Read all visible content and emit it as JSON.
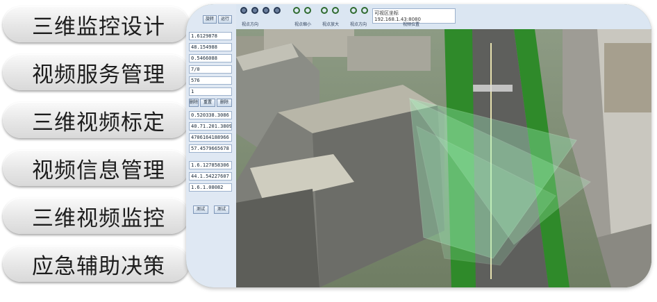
{
  "menu": {
    "items": [
      {
        "label": "三维监控设计"
      },
      {
        "label": "视频服务管理"
      },
      {
        "label": "三维视频标定"
      },
      {
        "label": "视频信息管理"
      },
      {
        "label": "三维视频监控"
      },
      {
        "label": "应急辅助决策"
      }
    ]
  },
  "app": {
    "panel": {
      "top_buttons": [
        "旋转",
        "运行"
      ],
      "fields": [
        "1.6129878",
        "48.154988",
        "0.5466088",
        "7/0",
        "576"
      ],
      "select_value": "1",
      "mid_buttons": [
        "删除",
        "重置",
        "删除"
      ],
      "cam_fields": [
        "0.520338.3086",
        "40.71.201.38090",
        "4706164188966",
        "57.4579665678"
      ],
      "lower_fields": [
        "1.6.127858306",
        "44.1.54227607",
        "1.6.1.08082"
      ],
      "bottom_buttons": [
        "测试",
        "测试"
      ]
    },
    "toolbar": {
      "groups": [
        "视点方向",
        "视点缩小",
        "视点放大",
        "视点方向",
        "视频位置"
      ],
      "coord_line1": "可视区坐标",
      "coord_line2": "192.168.1.43:8080"
    }
  },
  "colors": {
    "menu_bg_top": "#fafafa",
    "menu_bg_bottom": "#d9d9d9",
    "menu_text": "#1d1d1d",
    "frustum": "#9af0b8"
  }
}
